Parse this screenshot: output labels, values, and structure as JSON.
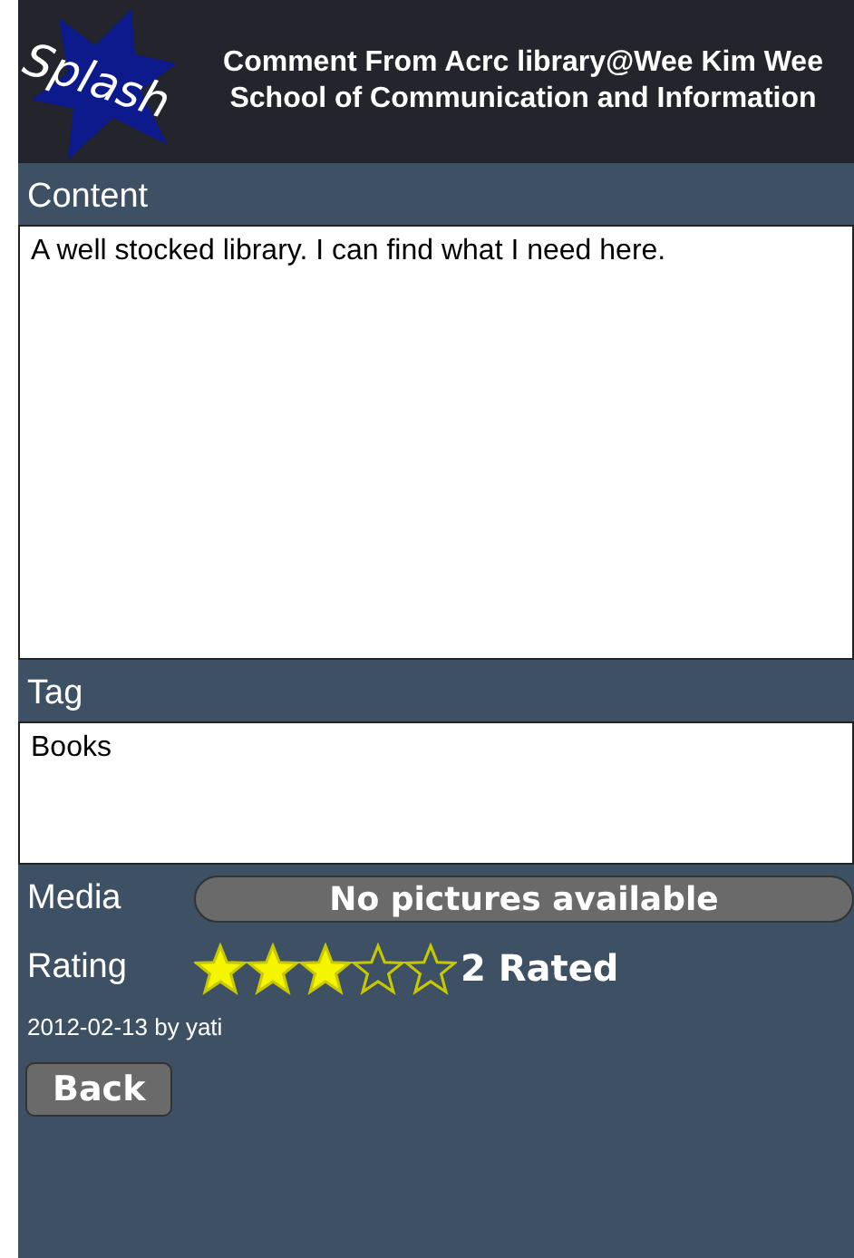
{
  "header": {
    "logo": "Splash",
    "title": "Comment From Acrc library@Wee Kim Wee School of Communication and Information"
  },
  "content": {
    "label": "Content",
    "value": "A well stocked library. I can find what I need here."
  },
  "tag": {
    "label": "Tag",
    "value": "Books"
  },
  "media": {
    "label": "Media",
    "button": "No pictures available"
  },
  "rating": {
    "label": "Rating",
    "stars": 3,
    "count": "2 Rated"
  },
  "byline": "2012-02-13 by yati",
  "buttons": [
    "Back"
  ]
}
